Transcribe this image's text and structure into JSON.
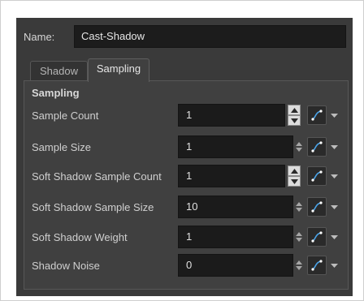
{
  "name_label": "Name:",
  "name_value": "Cast-Shadow",
  "tabs": [
    {
      "label": "Shadow",
      "active": false
    },
    {
      "label": "Sampling",
      "active": true
    }
  ],
  "group_title": "Sampling",
  "rows": [
    {
      "label": "Sample Count",
      "value": "1",
      "control": "stepper"
    },
    {
      "label": "Sample Size",
      "value": "1",
      "control": "spin"
    },
    {
      "label": "Soft Shadow Sample Count",
      "value": "1",
      "control": "stepper"
    },
    {
      "label": "Soft Shadow Sample Size",
      "value": "10",
      "control": "spin"
    },
    {
      "label": "Soft Shadow Weight",
      "value": "1",
      "control": "spin"
    },
    {
      "label": "Shadow Noise",
      "value": "0",
      "control": "spin"
    }
  ],
  "icons": {
    "stepper_up": "arrow-up-icon",
    "stepper_down": "arrow-down-icon",
    "spin": "up-down-arrows-icon",
    "function": "function-curve-icon",
    "menu": "dropdown-arrow-icon"
  },
  "colors": {
    "panel_bg": "#3a3a3a",
    "field_bg": "#1b1b1b",
    "curve_accent": "#4aa3e8"
  }
}
